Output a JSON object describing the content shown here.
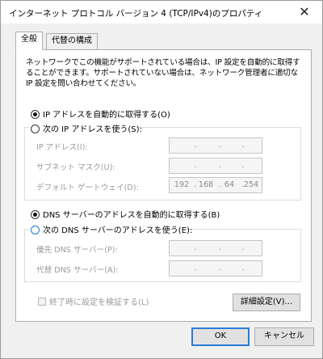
{
  "window": {
    "title": "インターネット プロトコル バージョン 4 (TCP/IPv4)のプロパティ",
    "close_glyph": "✕"
  },
  "tabs": [
    {
      "label": "全般",
      "active": true
    },
    {
      "label": "代替の構成",
      "active": false
    }
  ],
  "description": "ネットワークでこの機能がサポートされている場合は、IP 設定を自動的に取得することができます。サポートされていない場合は、ネットワーク管理者に適切な IP 設定を問い合わせてください。",
  "ip_mode": {
    "auto_label": "IP アドレスを自動的に取得する(O)",
    "manual_label": "次の IP アドレスを使う(S):",
    "selected": "auto"
  },
  "ip_fields": {
    "ip_address": {
      "label": "IP アドレス(I):",
      "octets": [
        "",
        "",
        "",
        ""
      ]
    },
    "subnet_mask": {
      "label": "サブネット マスク(U):",
      "octets": [
        "",
        "",
        "",
        ""
      ]
    },
    "default_gateway": {
      "label": "デフォルト ゲートウェイ(D):",
      "octets": [
        "192",
        "168",
        "64",
        "254"
      ]
    }
  },
  "dns_mode": {
    "auto_label": "DNS サーバーのアドレスを自動的に取得する(B)",
    "manual_label": "次の DNS サーバーのアドレスを使う(E):",
    "selected": "auto"
  },
  "dns_fields": {
    "preferred": {
      "label": "優先 DNS サーバー(P):",
      "octets": [
        "",
        "",
        "",
        ""
      ]
    },
    "alternate": {
      "label": "代替 DNS サーバー(A):",
      "octets": [
        "",
        "",
        "",
        ""
      ]
    }
  },
  "validate_on_exit": {
    "label": "終了時に設定を検証する(L)",
    "checked": false
  },
  "buttons": {
    "advanced": "詳細設定(V)...",
    "ok": "OK",
    "cancel": "キャンセル"
  },
  "dot": "."
}
